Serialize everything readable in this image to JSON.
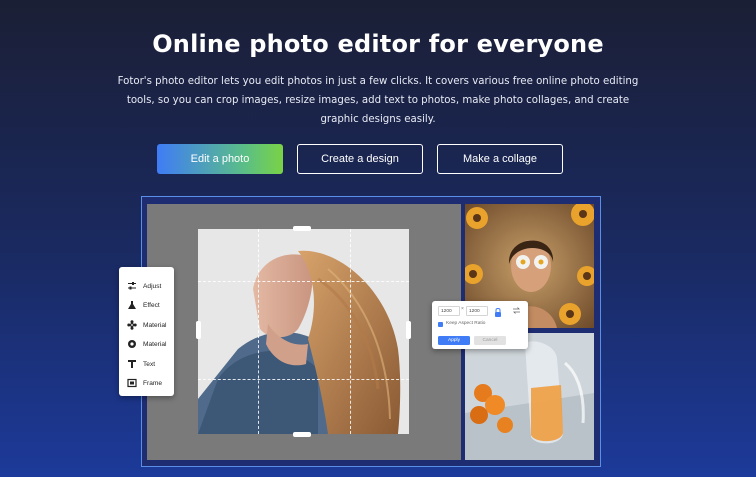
{
  "hero": {
    "title": "Online photo editor for everyone",
    "description_line1": "Fotor's photo editor lets you edit photos in just a few clicks. It covers various free online photo editing",
    "description_line2": "tools, so you can crop images, resize images, add text to photos, make photo collages, and create",
    "description_line3": "graphic designs easily."
  },
  "cta": {
    "edit_photo": "Edit a photo",
    "create_design": "Create a design",
    "make_collage": "Make a collage"
  },
  "tools": [
    {
      "label": "Adjust",
      "icon": "sliders-icon"
    },
    {
      "label": "Effect",
      "icon": "flask-icon"
    },
    {
      "label": "Material",
      "icon": "flower-icon"
    },
    {
      "label": "Material",
      "icon": "circle-icon"
    },
    {
      "label": "Text",
      "icon": "text-icon"
    },
    {
      "label": "Frame",
      "icon": "frame-icon"
    }
  ],
  "resize_popup": {
    "width_value": "1200",
    "separator": "×",
    "height_value": "1200",
    "keep_aspect_label": "Keep Aspect Ratio",
    "apply_label": "Apply",
    "cancel_label": "Cancel"
  },
  "colors": {
    "accent_blue": "#3f7cf6",
    "accent_green": "#7ad245",
    "frame_border": "#5b8ee6"
  }
}
